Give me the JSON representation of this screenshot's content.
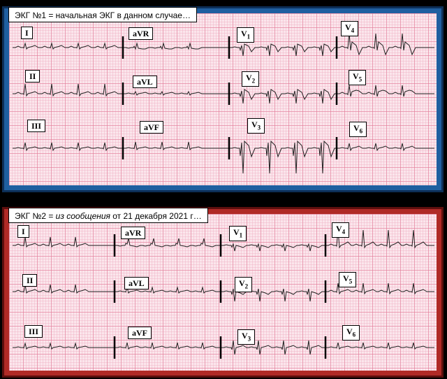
{
  "ecg1": {
    "title": "ЭКГ №1 = начальная ЭКГ  в данном случае…",
    "leads": [
      "I",
      "aVR",
      "V",
      "aVL",
      "V",
      "aVF",
      "V",
      "V",
      "II",
      "V",
      "III",
      "V"
    ]
  },
  "ecg2": {
    "title_prefix": "ЭКГ №2 = ",
    "title_italic": "из сообщения",
    "title_suffix": " от 21 декабря 2021 г…"
  },
  "lead_names": {
    "I": "I",
    "II": "II",
    "III": "III",
    "aVR": "aVR",
    "aVL": "aVL",
    "aVF": "aVF",
    "V": "V",
    "s1": "1",
    "s2": "2",
    "s3": "3",
    "s4": "4",
    "s5": "5",
    "s6": "6"
  },
  "colors": {
    "panel1_frame": "#1f5fa0",
    "panel2_frame": "#b02a26",
    "grid_bg": "#fbe6ec",
    "grid_line": "#e27896"
  }
}
